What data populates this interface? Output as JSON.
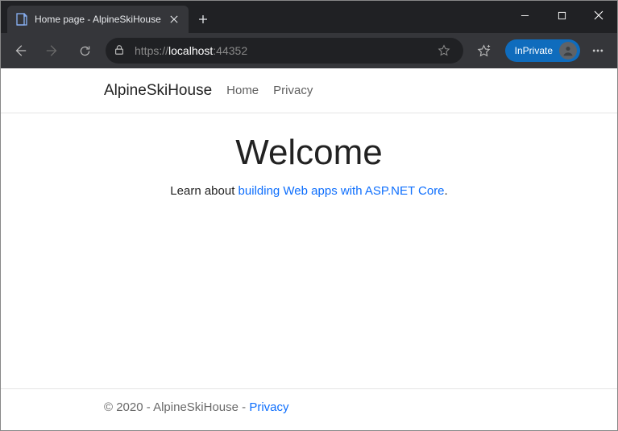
{
  "browser": {
    "tab_title": "Home page - AlpineSkiHouse",
    "url": {
      "scheme": "https://",
      "host": "localhost",
      "port": ":44352"
    },
    "inprivate_label": "InPrivate"
  },
  "site": {
    "brand": "AlpineSkiHouse",
    "nav": {
      "home": "Home",
      "privacy": "Privacy"
    }
  },
  "main": {
    "heading": "Welcome",
    "lead_prefix": "Learn about ",
    "lead_link": "building Web apps with ASP.NET Core",
    "lead_suffix": "."
  },
  "footer": {
    "text": "© 2020 - AlpineSkiHouse - ",
    "privacy": "Privacy"
  }
}
